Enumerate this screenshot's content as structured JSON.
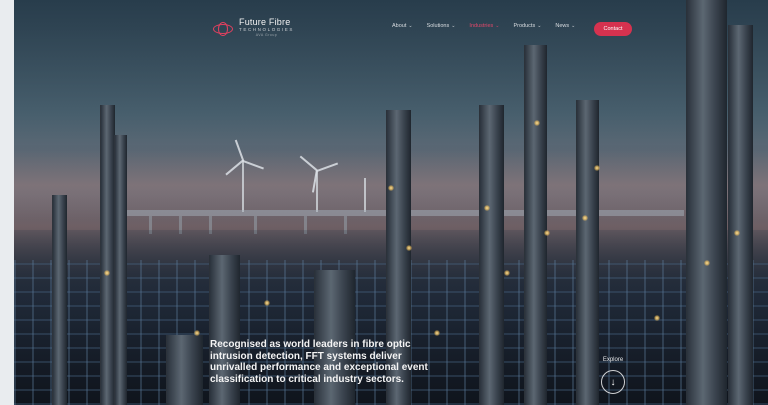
{
  "brand": {
    "name": "Future Fibre",
    "sub": "TECHNOLOGIES",
    "tag": "AVA Group",
    "accent": "#d6324f"
  },
  "nav": {
    "items": [
      {
        "label": "About",
        "has_dropdown": true,
        "active": false
      },
      {
        "label": "Solutions",
        "has_dropdown": true,
        "active": false
      },
      {
        "label": "Industries",
        "has_dropdown": true,
        "active": true
      },
      {
        "label": "Products",
        "has_dropdown": true,
        "active": false
      },
      {
        "label": "News",
        "has_dropdown": true,
        "active": false
      }
    ],
    "caret": "⌄",
    "contact_label": "Contact"
  },
  "hero": {
    "headline": "Recognised as world leaders in fibre optic intrusion detection, FFT systems deliver unrivalled performance and exceptional event classification to critical industry sectors.",
    "explore_label": "Explore",
    "explore_icon": "arrow-down-icon",
    "explore_glyph": "↓"
  }
}
